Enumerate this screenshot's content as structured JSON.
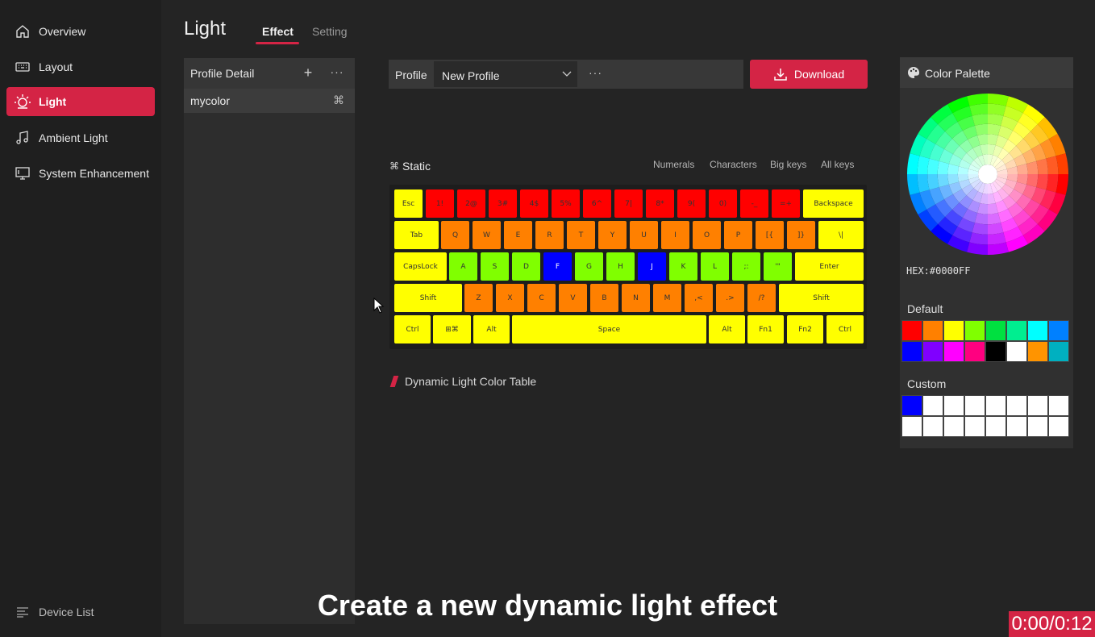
{
  "sidebar": {
    "items": [
      {
        "label": "Overview",
        "icon": "home-icon"
      },
      {
        "label": "Layout",
        "icon": "keyboard-icon"
      },
      {
        "label": "Light",
        "icon": "sun-icon",
        "active": true
      },
      {
        "label": "Ambient Light",
        "icon": "music-note-icon"
      },
      {
        "label": "System Enhancement",
        "icon": "monitor-icon"
      }
    ],
    "device_list": "Device List"
  },
  "header": {
    "title": "Light",
    "tabs": [
      {
        "label": "Effect",
        "active": true
      },
      {
        "label": "Setting"
      }
    ]
  },
  "profile_panel": {
    "title": "Profile Detail",
    "add": "+",
    "more": "···",
    "items": [
      {
        "label": "mycolor",
        "icon": "command-icon"
      }
    ]
  },
  "profile_bar": {
    "label": "Profile",
    "selected": "New Profile",
    "more": "···",
    "download": "Download"
  },
  "static": {
    "label": "Static",
    "filters": [
      "Numerals",
      "Characters",
      "Big keys",
      "All keys"
    ]
  },
  "keyboard": {
    "colors": {
      "red": "#ff0000",
      "orange": "#ff8000",
      "yellow": "#ffff00",
      "green": "#80ff00",
      "blue": "#0000ff"
    },
    "rows": [
      [
        [
          "Esc",
          "yellow"
        ],
        [
          "1!",
          "red"
        ],
        [
          "2@",
          "red"
        ],
        [
          "3#",
          "red"
        ],
        [
          "4$",
          "red"
        ],
        [
          "5%",
          "red"
        ],
        [
          "6^",
          "red"
        ],
        [
          "7|",
          "red"
        ],
        [
          "8*",
          "red"
        ],
        [
          "9(",
          "red"
        ],
        [
          "0)",
          "red"
        ],
        [
          "-_",
          "red"
        ],
        [
          "=+",
          "red"
        ],
        [
          "Backspace",
          "yellow"
        ]
      ],
      [
        [
          "Tab",
          "yellow"
        ],
        [
          "Q",
          "orange"
        ],
        [
          "W",
          "orange"
        ],
        [
          "E",
          "orange"
        ],
        [
          "R",
          "orange"
        ],
        [
          "T",
          "orange"
        ],
        [
          "Y",
          "orange"
        ],
        [
          "U",
          "orange"
        ],
        [
          "I",
          "orange"
        ],
        [
          "O",
          "orange"
        ],
        [
          "P",
          "orange"
        ],
        [
          "[{",
          "orange"
        ],
        [
          "]}",
          "orange"
        ],
        [
          "\\|",
          "yellow"
        ]
      ],
      [
        [
          "CapsLock",
          "yellow"
        ],
        [
          "A",
          "green"
        ],
        [
          "S",
          "green"
        ],
        [
          "D",
          "green"
        ],
        [
          "F",
          "blue"
        ],
        [
          "G",
          "green"
        ],
        [
          "H",
          "green"
        ],
        [
          "J",
          "blue"
        ],
        [
          "K",
          "green"
        ],
        [
          "L",
          "green"
        ],
        [
          ";:",
          "green"
        ],
        [
          "'\"",
          "green"
        ],
        [
          "Enter",
          "yellow"
        ]
      ],
      [
        [
          "Shift",
          "yellow"
        ],
        [
          "Z",
          "orange"
        ],
        [
          "X",
          "orange"
        ],
        [
          "C",
          "orange"
        ],
        [
          "V",
          "orange"
        ],
        [
          "B",
          "orange"
        ],
        [
          "N",
          "orange"
        ],
        [
          "M",
          "orange"
        ],
        [
          ",<",
          "orange"
        ],
        [
          ".>",
          "orange"
        ],
        [
          "/?",
          "orange"
        ],
        [
          "Shift",
          "yellow"
        ]
      ],
      [
        [
          "Ctrl",
          "yellow"
        ],
        [
          "⊞⌘",
          "yellow"
        ],
        [
          "Alt",
          "yellow"
        ],
        [
          "Space",
          "yellow"
        ],
        [
          "Alt",
          "yellow"
        ],
        [
          "Fn1",
          "yellow"
        ],
        [
          "Fn2",
          "yellow"
        ],
        [
          "Ctrl",
          "yellow"
        ]
      ]
    ]
  },
  "dynamic_table": "Dynamic Light Color Table",
  "palette": {
    "title": "Color Palette",
    "hex": "HEX:#0000FF",
    "default_label": "Default",
    "default_colors": [
      "#ff0000",
      "#ff8000",
      "#ffff00",
      "#80ff00",
      "#00e040",
      "#00ee90",
      "#00ffff",
      "#0080ff",
      "#0000ff",
      "#8000ff",
      "#ff00ff",
      "#ff0080",
      "#000000",
      "#ffffff",
      "#ff9400",
      "#00b0c0"
    ],
    "custom_label": "Custom",
    "custom_colors": [
      "#0000ff",
      "#ffffff",
      "#ffffff",
      "#ffffff",
      "#ffffff",
      "#ffffff",
      "#ffffff",
      "#ffffff",
      "#ffffff",
      "#ffffff",
      "#ffffff",
      "#ffffff",
      "#ffffff",
      "#ffffff",
      "#ffffff",
      "#ffffff"
    ]
  },
  "caption": "Create a new dynamic light effect",
  "timer": "0:00/0:12"
}
